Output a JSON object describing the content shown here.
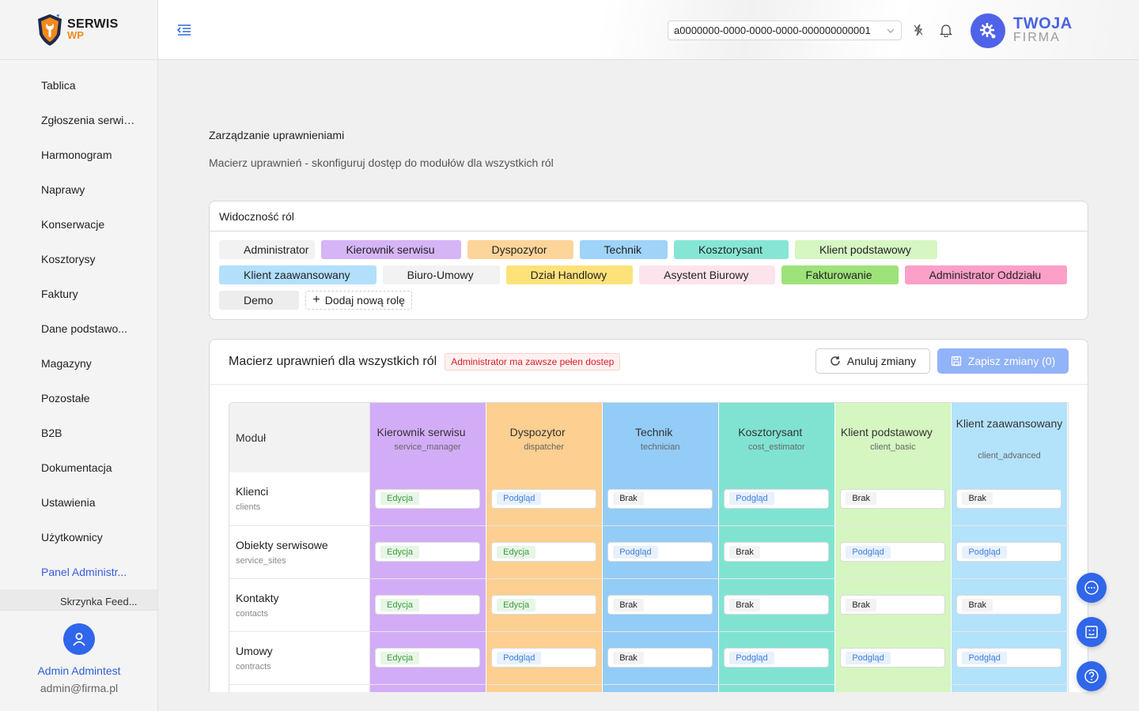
{
  "brand": {
    "line1": "SERWIS",
    "line2": "WP"
  },
  "sidebar": {
    "items": [
      {
        "label": "Tablica",
        "icon": "gauge-icon",
        "chevron": false
      },
      {
        "label": "Zgłoszenia serwiso...",
        "icon": "alarm-icon",
        "chevron": false
      },
      {
        "label": "Harmonogram",
        "icon": "calendar-icon",
        "chevron": false
      },
      {
        "label": "Naprawy",
        "icon": "file-icon",
        "chevron": false
      },
      {
        "label": "Konserwacje",
        "icon": "wrench-icon",
        "chevron": false
      },
      {
        "label": "Kosztorysy",
        "icon": "file-icon",
        "chevron": false
      },
      {
        "label": "Faktury",
        "icon": "hash-icon",
        "chevron": true
      },
      {
        "label": "Dane podstawo...",
        "icon": "database-icon",
        "chevron": true
      },
      {
        "label": "Magazyny",
        "icon": "warehouse-icon",
        "chevron": true
      },
      {
        "label": "Pozostałe",
        "icon": "grid-icon",
        "chevron": true
      },
      {
        "label": "B2B",
        "icon": "user-icon",
        "chevron": true
      },
      {
        "label": "Dokumentacja",
        "icon": "file-icon",
        "chevron": false
      },
      {
        "label": "Ustawienia",
        "icon": "gear-icon",
        "chevron": false
      },
      {
        "label": "Użytkownicy",
        "icon": "user-icon",
        "chevron": false
      },
      {
        "label": "Panel Administr...",
        "icon": "shield-check-icon",
        "chevron": true
      }
    ],
    "sub_item": "Skrzynka Feed..."
  },
  "user": {
    "name": "Admin Admintest",
    "email": "admin@firma.pl"
  },
  "topbar": {
    "tenant_value": "a0000000-0000-0000-0000-000000000001",
    "company_line1": "TWOJA",
    "company_line2": "FIRMA"
  },
  "page": {
    "title": "Zarządzanie uprawnieniami",
    "subtitle": "Macierz uprawnień - skonfiguruj dostęp do modułów dla wszystkich ról"
  },
  "roles_card": {
    "title": "Widoczność ról",
    "add_label": "Dodaj nową rolę",
    "roles": [
      {
        "label": "Administrator",
        "color": "#f2f2f2",
        "hidden": true,
        "editable": false
      },
      {
        "label": "Kierownik serwisu",
        "color": "#d6b5f7",
        "hidden": false,
        "editable": true
      },
      {
        "label": "Dyspozytor",
        "color": "#fdd59a",
        "hidden": false,
        "editable": true
      },
      {
        "label": "Technik",
        "color": "#9fd3f8",
        "hidden": false,
        "editable": true
      },
      {
        "label": "Kosztorysant",
        "color": "#86e6d6",
        "hidden": false,
        "editable": true
      },
      {
        "label": "Klient podstawowy",
        "color": "#d6f6c2",
        "hidden": false,
        "editable": true
      },
      {
        "label": "Klient zaawansowany",
        "color": "#b2e0fb",
        "hidden": false,
        "editable": true
      },
      {
        "label": "Biuro-Umowy",
        "color": "#f2f2f2",
        "hidden": false,
        "editable": true
      },
      {
        "label": "Dział Handlowy",
        "color": "#fde27a",
        "hidden": false,
        "editable": true
      },
      {
        "label": "Asystent Biurowy",
        "color": "#fde4ec",
        "hidden": false,
        "editable": true
      },
      {
        "label": "Fakturowanie",
        "color": "#9ee27a",
        "hidden": false,
        "editable": true
      },
      {
        "label": "Administrator Oddziału",
        "color": "#fca0c8",
        "hidden": false,
        "editable": true
      },
      {
        "label": "Demo",
        "color": "#ededed",
        "hidden": false,
        "editable": true
      }
    ]
  },
  "matrix": {
    "title": "Macierz uprawnień dla wszystkich ról",
    "badge": "Administrator ma zawsze pełen dostep",
    "cancel_label": "Anuluj zmiany",
    "save_label": "Zapisz zmiany (0)",
    "module_header": "Moduł",
    "columns": [
      {
        "name": "Kierownik serwisu",
        "code": "service_manager",
        "color": "#d3acf7"
      },
      {
        "name": "Dyspozytor",
        "code": "dispatcher",
        "color": "#fdcf90"
      },
      {
        "name": "Technik",
        "code": "technician",
        "color": "#93ccf6"
      },
      {
        "name": "Kosztorysant",
        "code": "cost_estimator",
        "color": "#80e3d2"
      },
      {
        "name": "Klient podstawowy",
        "code": "client_basic",
        "color": "#d5f5c1"
      },
      {
        "name": "Klient zaawansowany",
        "code": "client_advanced",
        "color": "#b3e2fb"
      }
    ],
    "rows": [
      {
        "name": "Klienci",
        "code": "clients",
        "perms": [
          "Edycja",
          "Podgląd",
          "Brak",
          "Podgląd",
          "Brak",
          "Brak"
        ]
      },
      {
        "name": "Obiekty serwisowe",
        "code": "service_sites",
        "perms": [
          "Edycja",
          "Edycja",
          "Podgląd",
          "Brak",
          "Podgląd",
          "Podgląd"
        ]
      },
      {
        "name": "Kontakty",
        "code": "contacts",
        "perms": [
          "Edycja",
          "Edycja",
          "Brak",
          "Brak",
          "Brak",
          "Brak"
        ]
      },
      {
        "name": "Umowy",
        "code": "contracts",
        "perms": [
          "Edycja",
          "Podgląd",
          "Brak",
          "Podgląd",
          "Podgląd",
          "Podgląd"
        ]
      },
      {
        "name": "",
        "code": "",
        "perms": [
          "",
          "",
          "",
          "",
          "",
          ""
        ]
      }
    ]
  },
  "colors": {
    "accent": "#2f66ea",
    "save_disabled": "#91b3f7"
  }
}
